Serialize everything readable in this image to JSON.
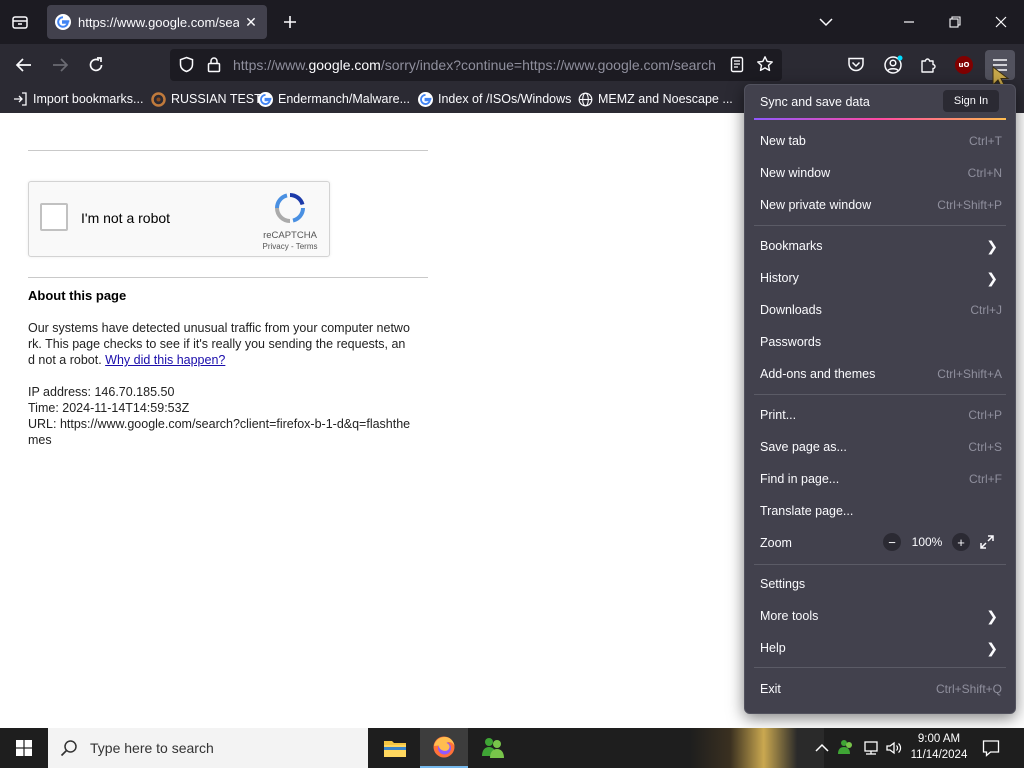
{
  "browser": {
    "tab": {
      "title": "https://www.google.com/searc",
      "close": "✕"
    },
    "address": {
      "prefix": "https://www.",
      "domain": "google.com",
      "rest": "/sorry/index?continue=https://www.google.com/search"
    },
    "bookmarks": [
      {
        "label": "Import bookmarks...",
        "icon": "import-icon"
      },
      {
        "label": "RUSSIAN TEST",
        "icon": "site-icon"
      },
      {
        "label": "Endermanch/Malware...",
        "icon": "google-icon"
      },
      {
        "label": "Index of /ISOs/Windows",
        "icon": "google-icon"
      },
      {
        "label": "MEMZ and Noescape ...",
        "icon": "globe-icon"
      }
    ],
    "colors": {
      "chrome_dark": "#1c1b22",
      "toolbar": "#2b2a33",
      "menu": "#42414d",
      "accent": "#0060df"
    }
  },
  "page": {
    "captcha": {
      "label": "I'm not a robot",
      "brand": "reCAPTCHA",
      "links": "Privacy - Terms"
    },
    "about_title": "About this page",
    "para_lines": [
      "Our systems have detected unusual traffic from your computer netwo",
      "rk. This page checks to see if it's really you sending the requests, an"
    ],
    "para_last": "d not a robot. ",
    "why_link": "Why did this happen?",
    "ip": "IP address: 146.70.185.50",
    "time": "Time: 2024-11-14T14:59:53Z",
    "url_line1": "URL: https://www.google.com/search?client=firefox-b-1-d&q=flashthe",
    "url_line2": "mes"
  },
  "menu": {
    "sync_label": "Sync and save data",
    "sign_in": "Sign In",
    "items": {
      "new_tab": {
        "label": "New tab",
        "shortcut": "Ctrl+T"
      },
      "new_window": {
        "label": "New window",
        "shortcut": "Ctrl+N"
      },
      "new_private": {
        "label": "New private window",
        "shortcut": "Ctrl+Shift+P"
      },
      "bookmarks": {
        "label": "Bookmarks"
      },
      "history": {
        "label": "History"
      },
      "downloads": {
        "label": "Downloads",
        "shortcut": "Ctrl+J"
      },
      "passwords": {
        "label": "Passwords"
      },
      "addons": {
        "label": "Add-ons and themes",
        "shortcut": "Ctrl+Shift+A"
      },
      "print": {
        "label": "Print...",
        "shortcut": "Ctrl+P"
      },
      "save_page": {
        "label": "Save page as...",
        "shortcut": "Ctrl+S"
      },
      "find": {
        "label": "Find in page...",
        "shortcut": "Ctrl+F"
      },
      "translate": {
        "label": "Translate page..."
      },
      "zoom": {
        "label": "Zoom",
        "value": "100%",
        "minus": "−",
        "plus": "+"
      },
      "settings": {
        "label": "Settings"
      },
      "more_tools": {
        "label": "More tools"
      },
      "help": {
        "label": "Help"
      },
      "exit": {
        "label": "Exit",
        "shortcut": "Ctrl+Shift+Q"
      }
    }
  },
  "taskbar": {
    "search_placeholder": "Type here to search",
    "time": "9:00 AM",
    "date": "11/14/2024"
  }
}
